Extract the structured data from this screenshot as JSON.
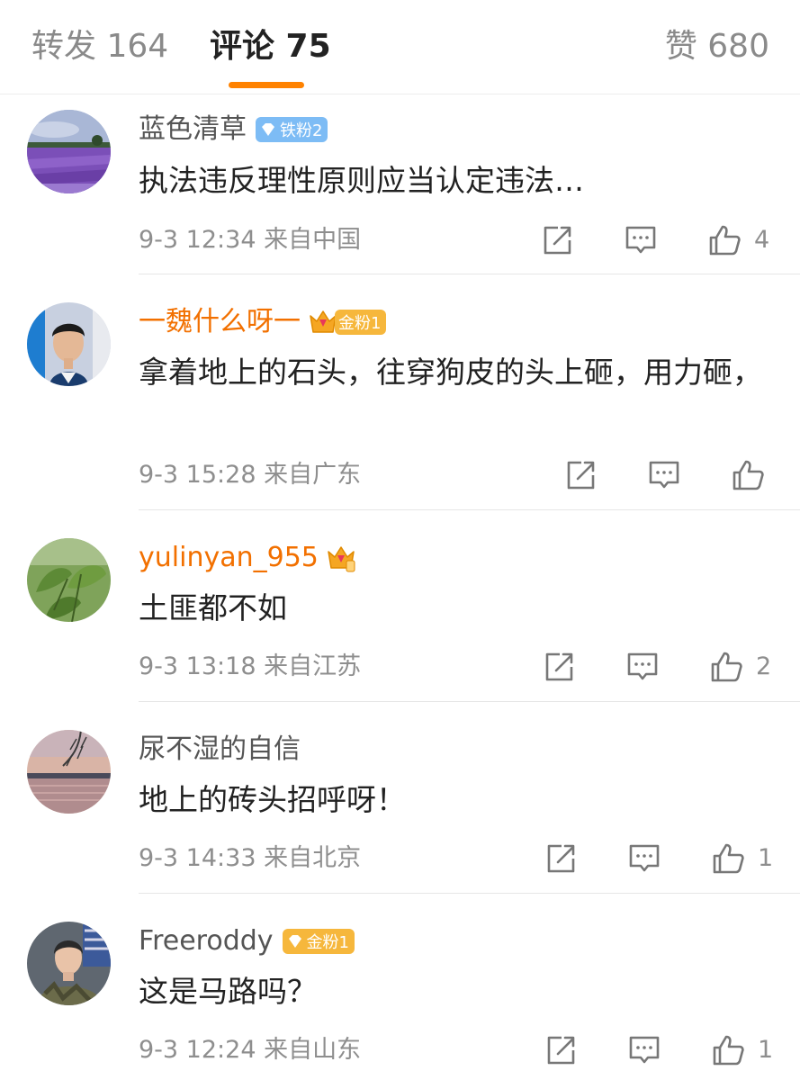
{
  "tabs": {
    "repost": "转发 164",
    "comments": "评论 75",
    "likes": "赞 680",
    "accent": "#ff8200"
  },
  "comments": [
    {
      "username": "蓝色清草",
      "badge": "铁粉2",
      "badge_type": "iron-fan",
      "text": "执法违反理性原则应当认定违法…",
      "time": "9-3 12:34",
      "location": "来自中国",
      "likes": "4",
      "avatar": "lavender-field-avatar"
    },
    {
      "username": "一魏什么呀一",
      "badge": "金粉1",
      "badge_type": "gold-fan-crown",
      "text": "拿着地上的石头，往穿狗皮的头上砸，用力砸，",
      "time": "9-3 15:28",
      "location": "来自广东",
      "likes": "",
      "avatar": "portrait-avatar"
    },
    {
      "username": "yulinyan_955",
      "badge": "",
      "badge_type": "crown-icon",
      "text": "土匪都不如",
      "time": "9-3 13:18",
      "location": "来自江苏",
      "likes": "2",
      "avatar": "green-leaves-avatar"
    },
    {
      "username": "尿不湿的自信",
      "badge": "",
      "badge_type": "none",
      "text": "地上的砖头招呼呀！",
      "time": "9-3 14:33",
      "location": "来自北京",
      "likes": "1",
      "avatar": "sunset-lake-avatar"
    },
    {
      "username": "Freeroddy",
      "badge": "金粉1",
      "badge_type": "gold-fan",
      "text": "这是马路吗？",
      "time": "9-3 12:24",
      "location": "来自山东",
      "likes": "1",
      "avatar": "soldier-avatar"
    }
  ]
}
